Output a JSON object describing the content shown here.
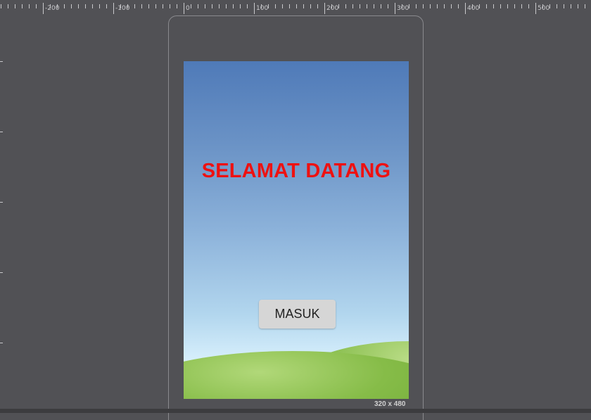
{
  "ruler": {
    "labels": [
      "-200",
      "-100",
      "0",
      "100",
      "200",
      "300",
      "400",
      "500"
    ]
  },
  "screen": {
    "title": "SELAMAT DATANG",
    "button_label": "MASUK",
    "size_label": "320 x 480"
  },
  "colors": {
    "title": "#ee1111",
    "button_bg": "#d6d6d6",
    "canvas_bg": "#515155",
    "sky_top": "#4f7ab8",
    "sky_bottom": "#e8f5fb",
    "grass": "#86bc48"
  }
}
